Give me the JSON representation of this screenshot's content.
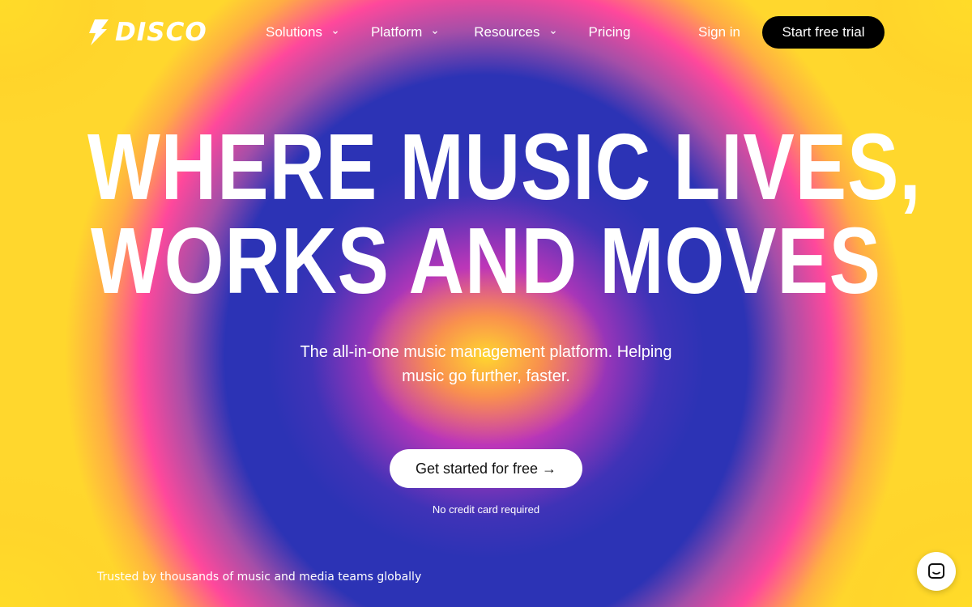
{
  "brand": {
    "name": "DISCO",
    "logo_icon": "lightning-bolt-icon"
  },
  "nav": {
    "items": [
      {
        "label": "Solutions",
        "has_dropdown": true
      },
      {
        "label": "Platform",
        "has_dropdown": true
      },
      {
        "label": "Resources",
        "has_dropdown": true
      },
      {
        "label": "Pricing",
        "has_dropdown": false
      }
    ],
    "signin_label": "Sign in",
    "trial_label": "Start free trial"
  },
  "hero": {
    "headline_line1": "WHERE MUSIC LIVES,",
    "headline_line2": "WORKS AND MOVES",
    "subtitle": "The all-in-one music management platform. Helping music go further, faster.",
    "cta_label": "Get started for free →",
    "cta_note": "No credit card required"
  },
  "trusted_text": "Trusted by thousands of music and media teams globally",
  "chat": {
    "icon": "chat-bubble-icon"
  },
  "colors": {
    "background_blue": "#2c33b5",
    "pink": "#ff3ca5",
    "yellow": "#ffd52a",
    "button_dark": "#000000",
    "button_light": "#ffffff"
  }
}
